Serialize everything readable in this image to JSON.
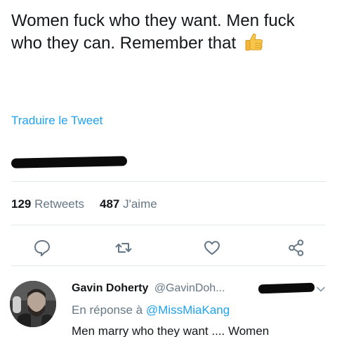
{
  "tweet": {
    "text": "Women fuck who they want. Men fuck who they can. Remember that",
    "emoji": "thumbs-up-icon",
    "translate_label": "Traduire le Tweet",
    "meta_redacted": "",
    "retweet_count": "129",
    "retweet_label": "Retweets",
    "like_count": "487",
    "like_label": "J'aime"
  },
  "actions": [
    {
      "name": "reply-icon"
    },
    {
      "name": "retweet-icon"
    },
    {
      "name": "like-icon"
    },
    {
      "name": "share-icon"
    }
  ],
  "reply": {
    "author_name": "Gavin Doherty",
    "author_handle": "@GavinDoh...",
    "in_reply_to_label": "En réponse à",
    "in_reply_to_handle": "@MissMiaKang",
    "text": "Men marry who they want .... Women"
  },
  "colors": {
    "text": "#14171a",
    "link": "#1da1f2",
    "secondary": "#657786",
    "divider": "#e1e8ed",
    "redaction": "#0b0b0b"
  }
}
